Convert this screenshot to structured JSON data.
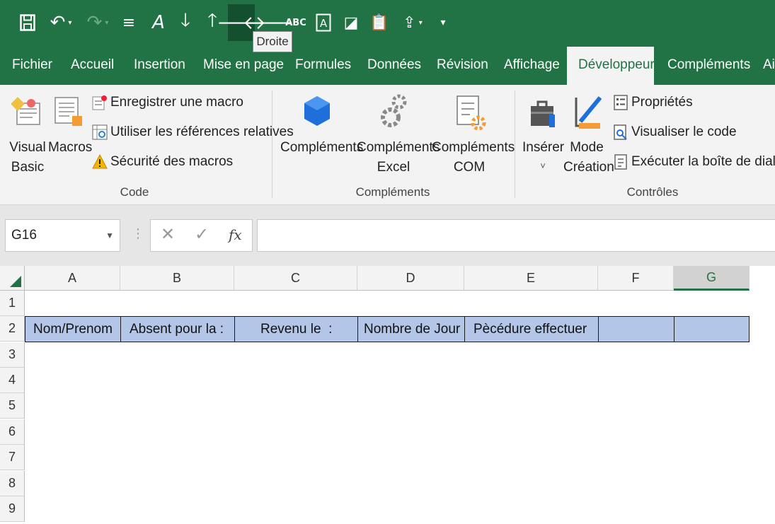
{
  "quick_access": {
    "tooltip": "Droite",
    "icons": [
      "save-icon",
      "undo-icon",
      "redo-icon",
      "list-icon",
      "text-style-icon",
      "arrow-down-icon",
      "arrow-up-icon",
      "arrow-right-icon",
      "arrow-left-icon",
      "spelling-icon",
      "text-box-icon",
      "shape-icon",
      "paste-icon",
      "share-icon",
      "customize-icon"
    ]
  },
  "tabs": [
    "Fichier",
    "Accueil",
    "Insertion",
    "Mise en page",
    "Formules",
    "Données",
    "Révision",
    "Affichage",
    "Développeur",
    "Compléments",
    "Ai"
  ],
  "active_tab": "Développeur",
  "ribbon": {
    "code": {
      "label": "Code",
      "visual_basic_1": "Visual",
      "visual_basic_2": "Basic",
      "macros": "Macros",
      "record_macro": "Enregistrer une macro",
      "relative_refs": "Utiliser les références relatives",
      "macro_security": "Sécurité des macros"
    },
    "complements": {
      "label": "Compléments",
      "addins": "Compléments",
      "excel_1": "Compléments",
      "excel_2": "Excel",
      "com_1": "Compléments",
      "com_2": "COM"
    },
    "controls": {
      "label": "Contrôles",
      "insert": "Insérer",
      "insert_caret": "˅",
      "design_1": "Mode",
      "design_2": "Création",
      "properties": "Propriétés",
      "view_code": "Visualiser le code",
      "run_dialog": "Exécuter la boîte de dialogue"
    }
  },
  "formula_bar": {
    "name_box": "G16",
    "cancel": "✕",
    "confirm": "✓",
    "fx": "fx",
    "formula": ""
  },
  "columns": [
    "A",
    "B",
    "C",
    "D",
    "E",
    "F",
    "G"
  ],
  "selected_column": "G",
  "rows": [
    "1",
    "2",
    "3",
    "4",
    "5",
    "6",
    "7",
    "8",
    "9"
  ],
  "row2": [
    "Nom/Prenom",
    "Absent pour la :",
    "Revenu le  :",
    "Nombre de Jour",
    "Pècédure effectuer",
    "",
    ""
  ],
  "colors": {
    "excel_green": "#217346",
    "header_fill": "#b4c6e7"
  }
}
